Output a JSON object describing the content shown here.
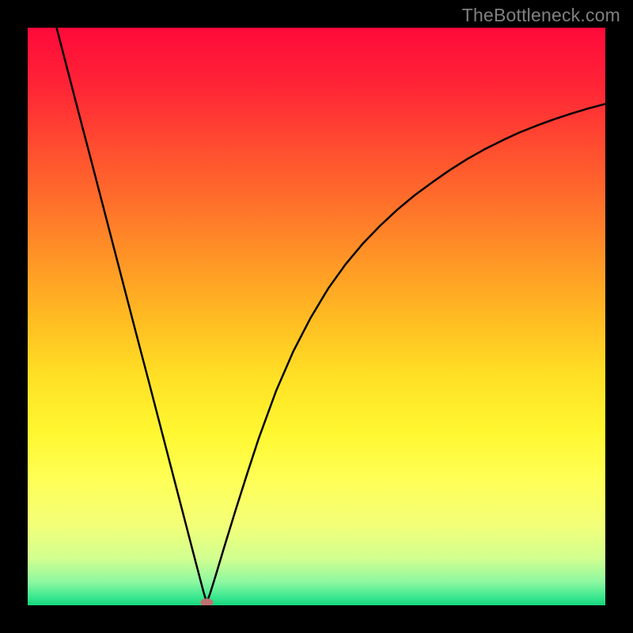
{
  "watermark": {
    "text": "TheBottleneck.com"
  },
  "chart_data": {
    "type": "line",
    "title": "",
    "xlabel": "",
    "ylabel": "",
    "xlim": [
      0,
      100
    ],
    "ylim": [
      0,
      100
    ],
    "min_x": 31.0,
    "min_y": 0.5,
    "marker": {
      "rx": 8,
      "ry": 5,
      "fill": "#c07070"
    },
    "curve_points": [
      {
        "x": 5.0,
        "y": 100.0
      },
      {
        "x": 7.0,
        "y": 92.3
      },
      {
        "x": 9.0,
        "y": 84.6
      },
      {
        "x": 11.0,
        "y": 77.0
      },
      {
        "x": 13.0,
        "y": 69.3
      },
      {
        "x": 15.0,
        "y": 61.6
      },
      {
        "x": 17.0,
        "y": 53.9
      },
      {
        "x": 19.0,
        "y": 46.2
      },
      {
        "x": 21.0,
        "y": 38.6
      },
      {
        "x": 23.0,
        "y": 30.9
      },
      {
        "x": 25.0,
        "y": 23.2
      },
      {
        "x": 27.0,
        "y": 15.5
      },
      {
        "x": 29.0,
        "y": 7.8
      },
      {
        "x": 30.0,
        "y": 4.0
      },
      {
        "x": 30.5,
        "y": 2.1
      },
      {
        "x": 31.0,
        "y": 0.5
      },
      {
        "x": 31.6,
        "y": 2.1
      },
      {
        "x": 32.5,
        "y": 5.0
      },
      {
        "x": 34.0,
        "y": 10.0
      },
      {
        "x": 36.0,
        "y": 16.5
      },
      {
        "x": 38.0,
        "y": 22.8
      },
      {
        "x": 40.0,
        "y": 28.9
      },
      {
        "x": 43.0,
        "y": 37.1
      },
      {
        "x": 46.0,
        "y": 44.0
      },
      {
        "x": 49.0,
        "y": 49.8
      },
      {
        "x": 52.0,
        "y": 54.8
      },
      {
        "x": 55.0,
        "y": 59.0
      },
      {
        "x": 58.0,
        "y": 62.6
      },
      {
        "x": 61.0,
        "y": 65.7
      },
      {
        "x": 64.0,
        "y": 68.5
      },
      {
        "x": 67.0,
        "y": 71.0
      },
      {
        "x": 70.0,
        "y": 73.2
      },
      {
        "x": 73.0,
        "y": 75.3
      },
      {
        "x": 76.0,
        "y": 77.2
      },
      {
        "x": 79.0,
        "y": 78.9
      },
      {
        "x": 82.0,
        "y": 80.4
      },
      {
        "x": 85.0,
        "y": 81.8
      },
      {
        "x": 88.0,
        "y": 83.0
      },
      {
        "x": 91.0,
        "y": 84.1
      },
      {
        "x": 94.0,
        "y": 85.1
      },
      {
        "x": 97.0,
        "y": 86.0
      },
      {
        "x": 100.0,
        "y": 86.8
      }
    ],
    "gradient_stops": [
      {
        "offset": 0.0,
        "color": "#ff0a3a"
      },
      {
        "offset": 0.1,
        "color": "#ff2436"
      },
      {
        "offset": 0.2,
        "color": "#ff4a30"
      },
      {
        "offset": 0.3,
        "color": "#ff6f2b"
      },
      {
        "offset": 0.4,
        "color": "#ff9526"
      },
      {
        "offset": 0.5,
        "color": "#ffba22"
      },
      {
        "offset": 0.6,
        "color": "#ffdf25"
      },
      {
        "offset": 0.7,
        "color": "#fff730"
      },
      {
        "offset": 0.78,
        "color": "#ffff55"
      },
      {
        "offset": 0.86,
        "color": "#f4ff78"
      },
      {
        "offset": 0.92,
        "color": "#d0ff90"
      },
      {
        "offset": 0.96,
        "color": "#8cf8a0"
      },
      {
        "offset": 0.985,
        "color": "#3de890"
      },
      {
        "offset": 1.0,
        "color": "#15d67a"
      }
    ]
  }
}
